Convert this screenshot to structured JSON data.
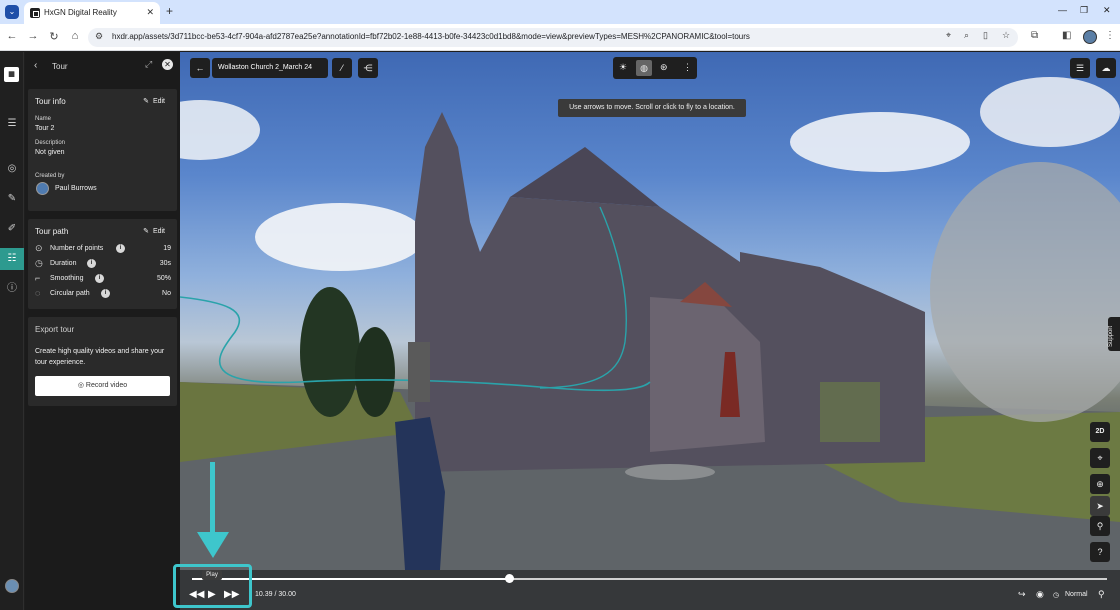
{
  "browser": {
    "tab_title": "HxGN Digital Reality",
    "url": "hxdr.app/assets/3d711bcc-be53-4cf7-904a-afd2787ea25e?annotationId=fbf72b02-1e88-4413-b0fe-34423c0d1bd8&mode=view&previewTypes=MESH%2CPANORAMIC&tool=tours"
  },
  "panel": {
    "title": "Tour",
    "tour_info": {
      "heading": "Tour info",
      "edit_label": "Edit",
      "name_label": "Name",
      "name_value": "Tour 2",
      "description_label": "Description",
      "description_value": "Not given",
      "created_by_label": "Created by",
      "creator": "Paul Burrows"
    },
    "tour_path": {
      "heading": "Tour path",
      "edit_label": "Edit",
      "rows": [
        {
          "label": "Number of points",
          "value": "19"
        },
        {
          "label": "Duration",
          "value": "30s"
        },
        {
          "label": "Smoothing",
          "value": "50%"
        },
        {
          "label": "Circular path",
          "value": "No"
        }
      ]
    },
    "export": {
      "heading": "Export tour",
      "description": "Create high quality videos and share your tour experience.",
      "button": "Record video"
    }
  },
  "viewer": {
    "asset_title": "Wollaston Church 2_March 24",
    "hint": "Use arrows to move. Scroll or click to fly to a location.",
    "mode_2d": "2D",
    "support": "Support",
    "playback": {
      "tooltip": "Play",
      "time": "10.39 / 30.00",
      "progress": 0.346,
      "speed": "Normal"
    }
  },
  "colors": {
    "accent": "#2d9a8f",
    "annotation": "#3ec6cc"
  }
}
